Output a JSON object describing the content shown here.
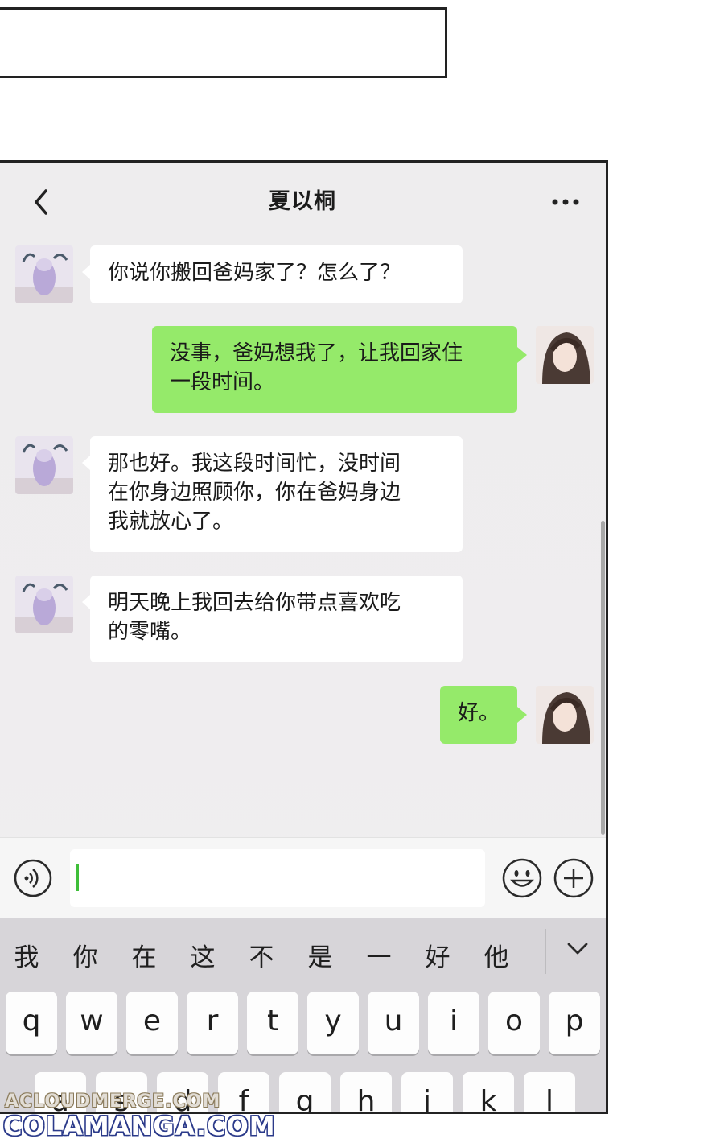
{
  "chat": {
    "title": "夏以桐"
  },
  "messages": [
    {
      "side": "in",
      "lines": [
        "你说你搬回爸妈家了？怎么了？"
      ]
    },
    {
      "side": "out",
      "lines": [
        "没事，爸妈想我了，让我回家住",
        "一段时间。"
      ]
    },
    {
      "side": "in",
      "lines": [
        "那也好。我这段时间忙，没时间",
        "在你身边照顾你，你在爸妈身边",
        "我就放心了。"
      ]
    },
    {
      "side": "in",
      "lines": [
        "明天晚上我回去给你带点喜欢吃",
        "的零嘴。"
      ]
    },
    {
      "side": "out",
      "lines": [
        "好。"
      ]
    }
  ],
  "input": {
    "value": ""
  },
  "keyboard": {
    "candidates": [
      "我",
      "你",
      "在",
      "这",
      "不",
      "是",
      "一",
      "好",
      "他"
    ],
    "row1": [
      "q",
      "w",
      "e",
      "r",
      "t",
      "y",
      "u",
      "i",
      "o",
      "p"
    ],
    "row2": [
      "a",
      "s",
      "d",
      "f",
      "g",
      "h",
      "j",
      "k",
      "l"
    ]
  },
  "watermark": {
    "line1": "ACLOUDMERGE.COM",
    "line2": "COLAMANGA.COM"
  },
  "colors": {
    "outgoing_bubble": "#95ea6a",
    "incoming_bubble": "#ffffff",
    "chat_background": "#eeedee",
    "keyboard_background": "#d7d5d9"
  },
  "icons": {
    "back": "chevron-left-icon",
    "more": "ellipsis-icon",
    "voice": "voice-icon",
    "emoji": "smiley-icon",
    "plus": "plus-icon",
    "collapse": "chevron-down-icon"
  }
}
